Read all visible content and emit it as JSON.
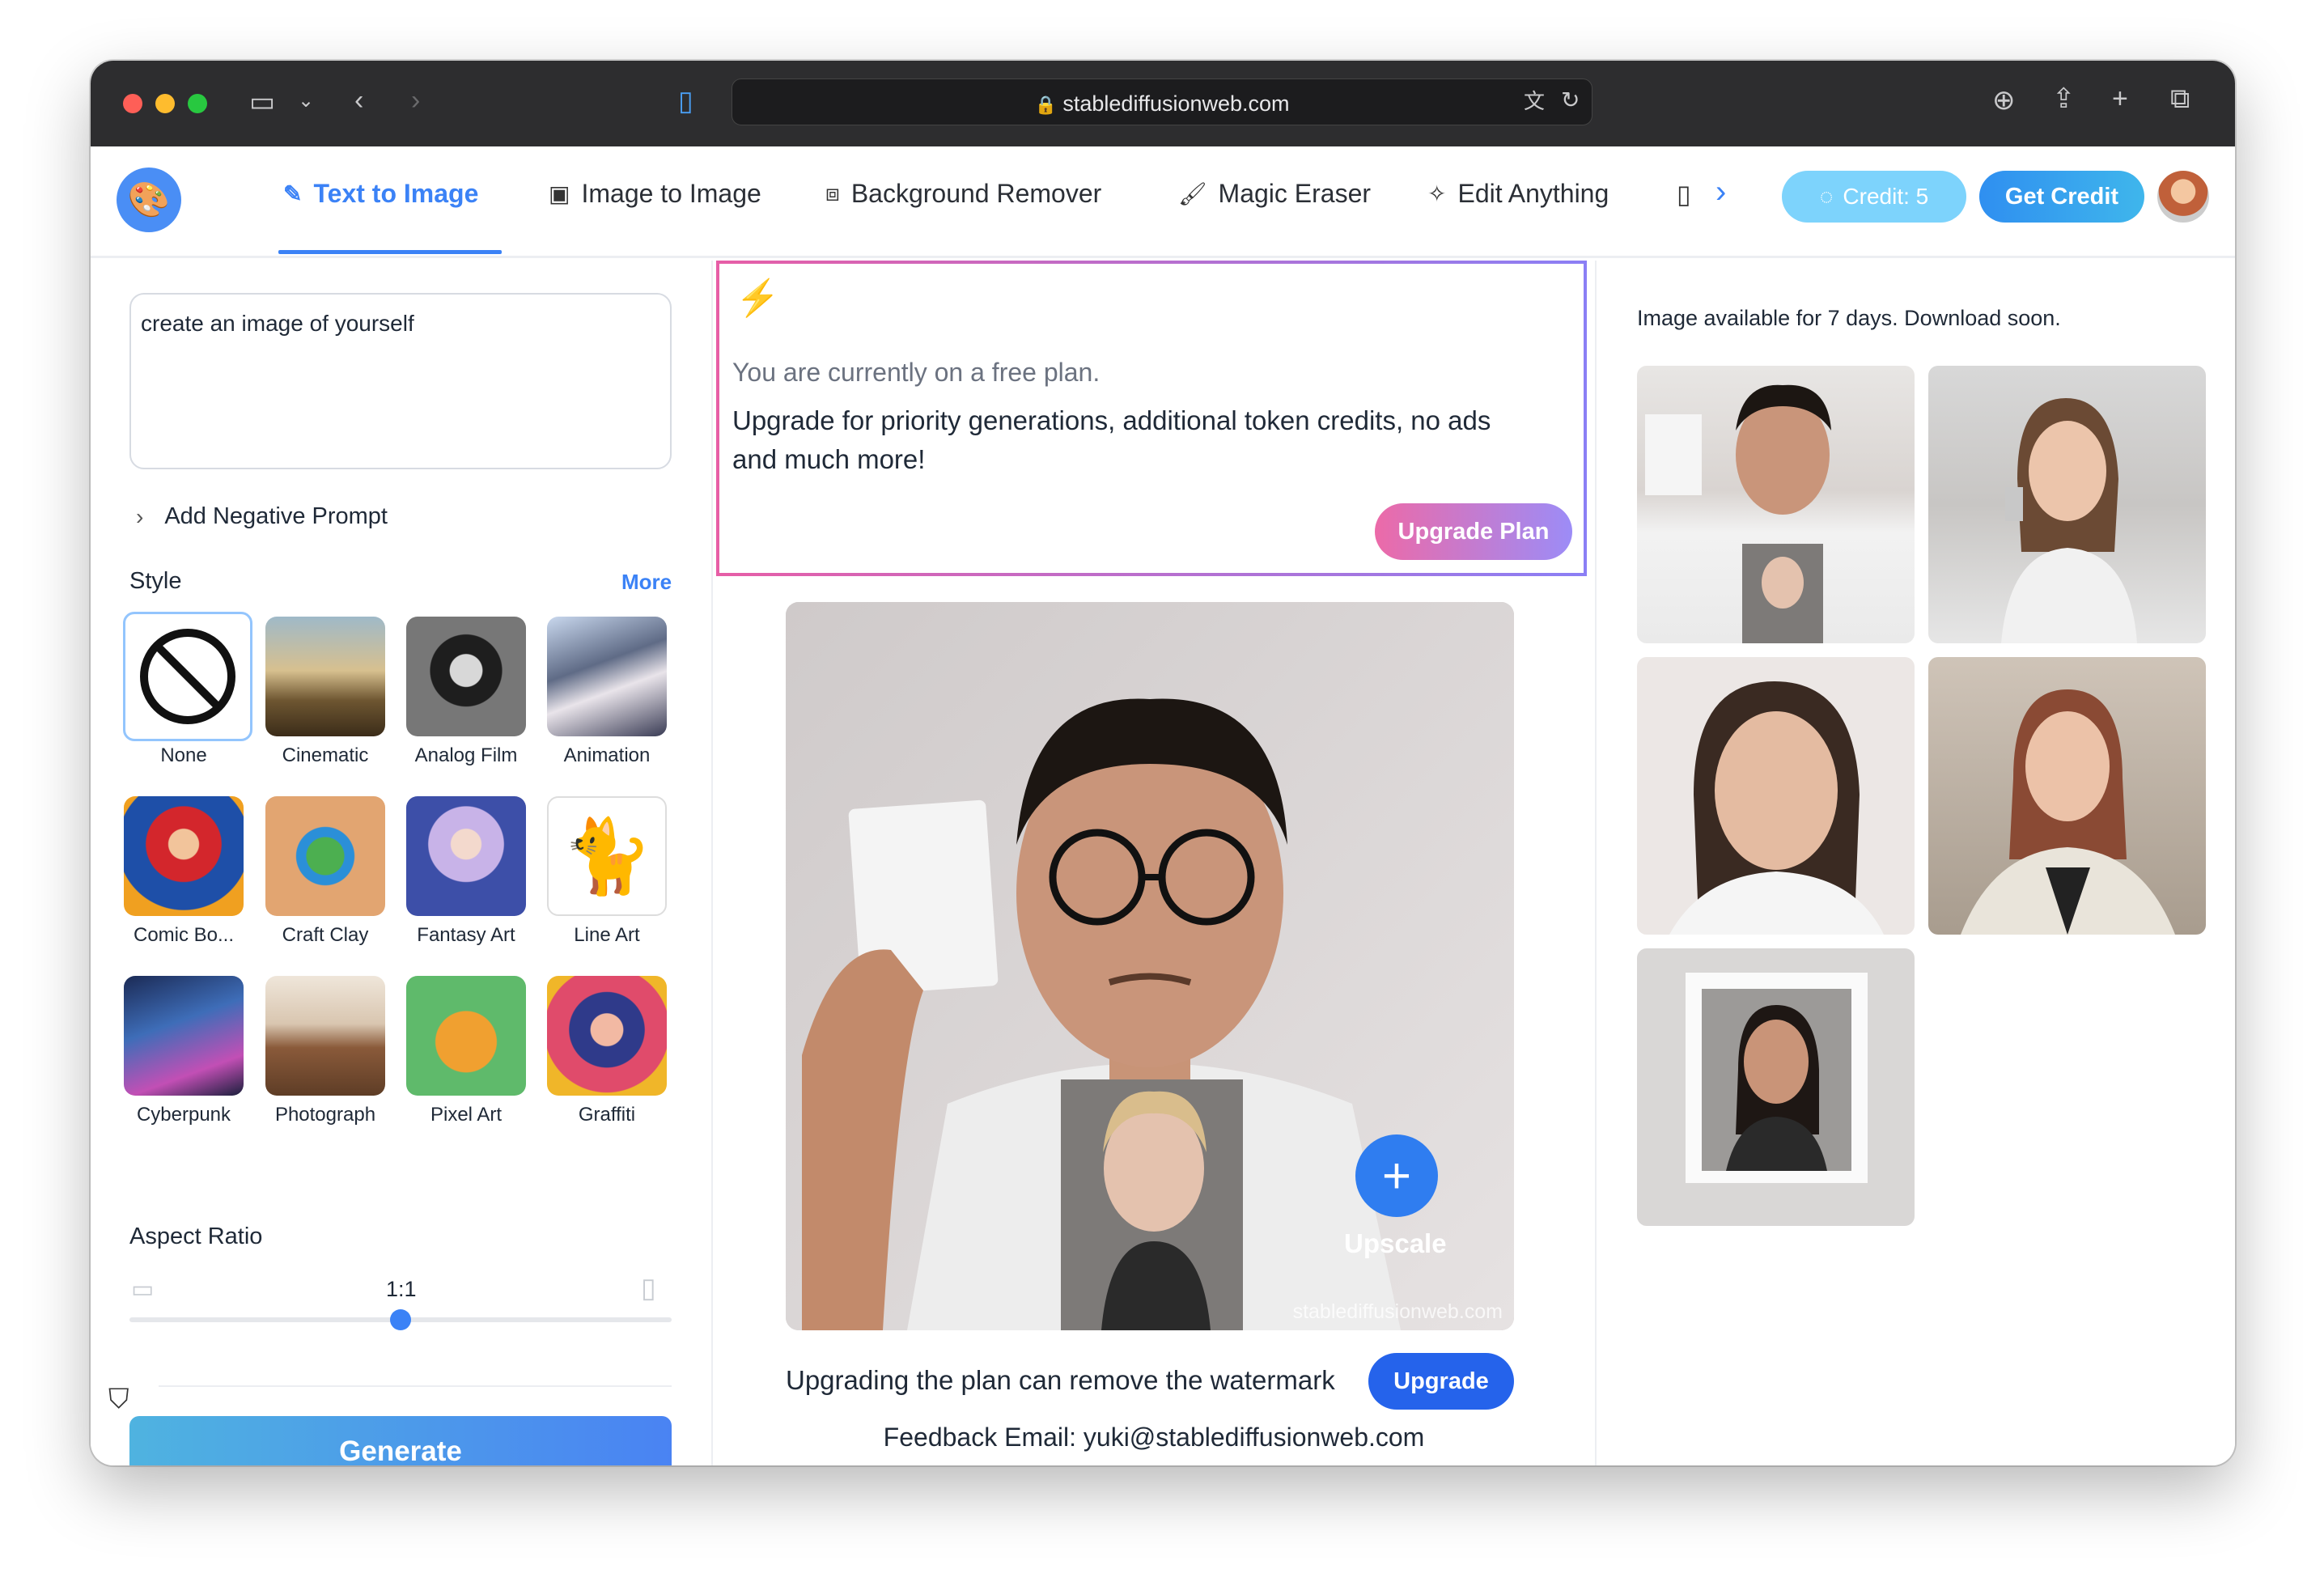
{
  "browser": {
    "url": "stablediffusionweb.com"
  },
  "nav": {
    "tabs": [
      {
        "label": "Text to Image",
        "icon": "wand-icon"
      },
      {
        "label": "Image to Image",
        "icon": "image-icon"
      },
      {
        "label": "Background Remover",
        "icon": "layers-icon"
      },
      {
        "label": "Magic Eraser",
        "icon": "brush-icon"
      },
      {
        "label": "Edit Anything",
        "icon": "sparkle-wand-icon"
      }
    ],
    "active_tab": "Text to Image",
    "credit_label": "Credit: 5",
    "get_credit_label": "Get Credit",
    "accent": "#3b82f6"
  },
  "left": {
    "prompt_value": "create an image of yourself",
    "negative_prompt_label": "Add Negative Prompt",
    "style_label": "Style",
    "more_label": "More",
    "styles": [
      {
        "label": "None"
      },
      {
        "label": "Cinematic"
      },
      {
        "label": "Analog Film"
      },
      {
        "label": "Animation"
      },
      {
        "label": "Comic Bo..."
      },
      {
        "label": "Craft Clay"
      },
      {
        "label": "Fantasy Art"
      },
      {
        "label": "Line Art"
      },
      {
        "label": "Cyberpunk"
      },
      {
        "label": "Photograph"
      },
      {
        "label": "Pixel Art"
      },
      {
        "label": "Graffiti"
      }
    ],
    "selected_style": "None",
    "aspect_ratio_label": "Aspect Ratio",
    "aspect_ratio_value": "1:1",
    "generate_label": "Generate"
  },
  "middle": {
    "promo_line1": "You are currently on a free plan.",
    "promo_line2": "Upgrade for priority generations, additional token credits, no ads and much more!",
    "upgrade_plan_label": "Upgrade Plan",
    "upscale_label": "Upscale",
    "watermark": "stablediffusionweb.com",
    "watermark_note": "Upgrading the plan can remove the watermark",
    "upgrade_label": "Upgrade",
    "feedback": "Feedback Email: yuki@stablediffusionweb.com"
  },
  "right": {
    "availability_note": "Image available for 7 days. Download soon."
  }
}
